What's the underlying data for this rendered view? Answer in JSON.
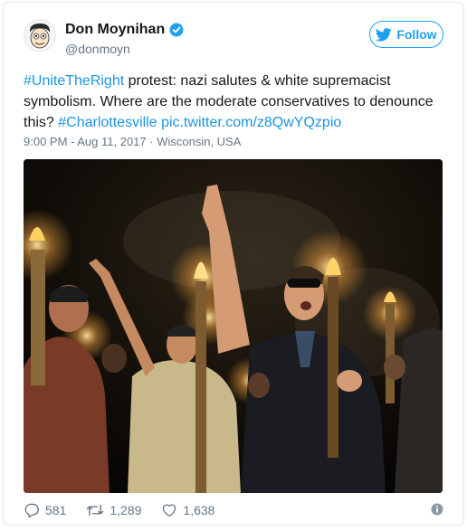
{
  "user": {
    "display_name": "Don Moynihan",
    "handle": "@donmoyn",
    "verified": true
  },
  "follow_button": {
    "label": "Follow"
  },
  "tweet": {
    "hashtag_1": "#UniteTheRight",
    "text_1": " protest: nazi salutes & white supremacist symbolism. Where are the moderate conservatives to denounce this? ",
    "hashtag_2": "#Charlottesville",
    "space": " ",
    "pic_link": "pic.twitter.com/z8QwYQzpio"
  },
  "meta": {
    "timestamp": "9:00 PM - Aug 11, 2017",
    "separator": " · ",
    "location": "Wisconsin, USA"
  },
  "actions": {
    "replies": "581",
    "retweets": "1,289",
    "likes": "1,638"
  },
  "colors": {
    "accent": "#1da1f2",
    "link": "#1b95e0",
    "muted": "#657786"
  }
}
